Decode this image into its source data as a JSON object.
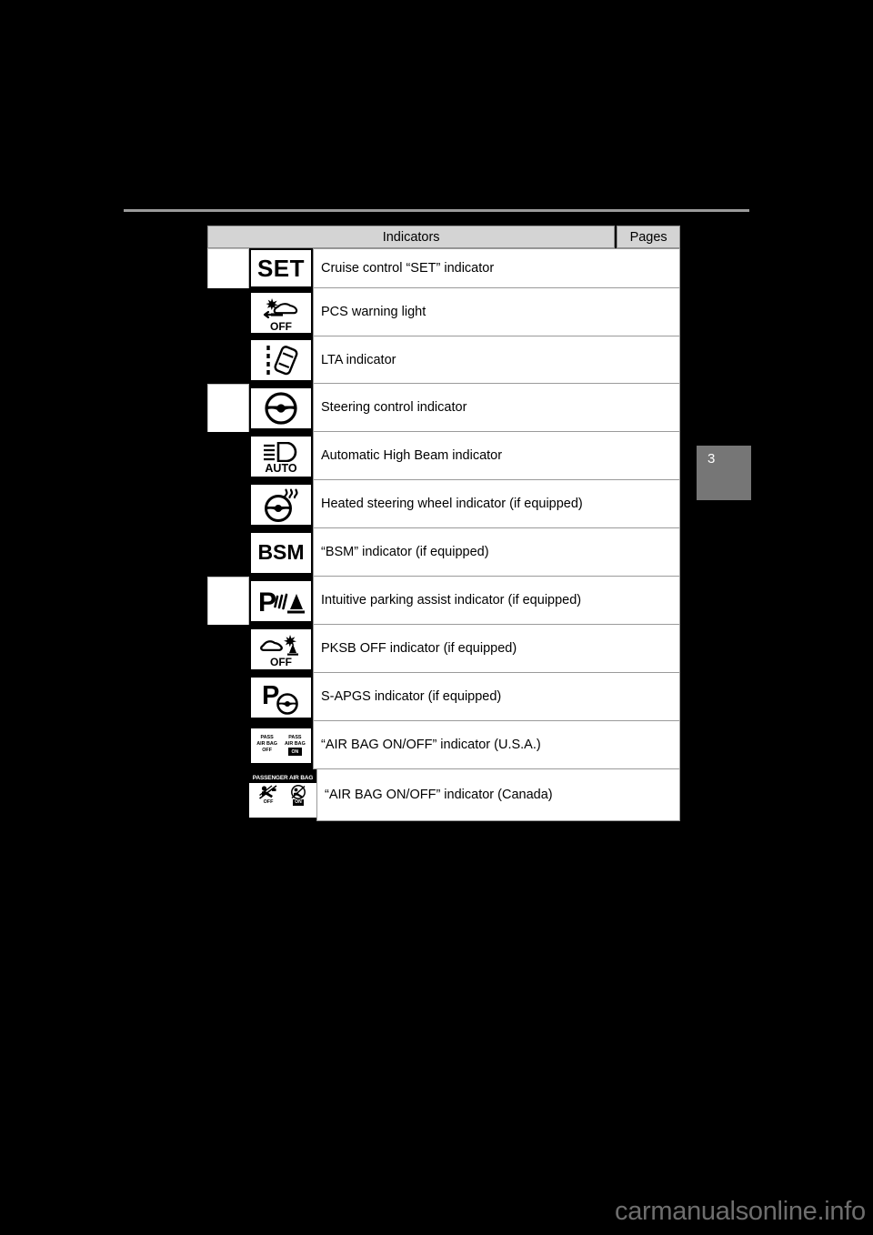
{
  "page": {
    "number": "3",
    "watermark": "carmanualsonline.info"
  },
  "table": {
    "headers": {
      "indicators": "Indicators",
      "pages": "Pages"
    },
    "rows": [
      {
        "icon": "cruise-control-set-icon",
        "icon_text": "SET",
        "description": "Cruise control “SET” indicator",
        "left_block": true,
        "page": ""
      },
      {
        "icon": "pcs-warning-off-icon",
        "icon_text": "OFF",
        "description": "PCS warning light",
        "left_block": false,
        "page": ""
      },
      {
        "icon": "lta-lane-tracing-icon",
        "icon_text": "",
        "description": "LTA indicator",
        "left_block": false,
        "page": ""
      },
      {
        "icon": "steering-wheel-icon",
        "icon_text": "",
        "description": "Steering control indicator",
        "left_block": true,
        "page": ""
      },
      {
        "icon": "automatic-high-beam-icon",
        "icon_text": "AUTO",
        "description": "Automatic High Beam indicator",
        "left_block": false,
        "page": ""
      },
      {
        "icon": "heated-steering-wheel-icon",
        "icon_text": "",
        "description": "Heated steering wheel indicator (if equipped)",
        "left_block": false,
        "page": ""
      },
      {
        "icon": "bsm-blind-spot-monitor-icon",
        "icon_text": "BSM",
        "description": "“BSM” indicator (if equipped)",
        "left_block": false,
        "page": ""
      },
      {
        "icon": "intuitive-parking-assist-icon",
        "icon_text": "P",
        "description": "Intuitive parking assist indicator (if equipped)",
        "left_block": true,
        "page": ""
      },
      {
        "icon": "pksb-off-icon",
        "icon_text": "OFF",
        "description": "PKSB OFF indicator (if equipped)",
        "left_block": false,
        "page": ""
      },
      {
        "icon": "s-apgs-icon",
        "icon_text": "P",
        "description": "S-APGS indicator (if equipped)",
        "left_block": false,
        "page": ""
      },
      {
        "icon": "air-bag-on-off-usa-icon",
        "icon_text": "PASS AIR BAG OFF / PASS AIR BAG ON",
        "description": "“AIR BAG ON/OFF” indicator (U.S.A.)",
        "left_block": false,
        "page": ""
      },
      {
        "icon": "air-bag-on-off-canada-icon",
        "icon_text": "PASSENGER AIR BAG",
        "description": "“AIR BAG ON/OFF” indicator (Canada)",
        "left_block": false,
        "page": ""
      }
    ],
    "airbag_usa": {
      "left_line1": "PASS",
      "left_line2": "AIR BAG",
      "left_line3": "OFF",
      "right_line1": "PASS",
      "right_line2": "AIR BAG",
      "right_badge": "ON"
    },
    "airbag_canada": {
      "title": "PASSENGER AIR BAG",
      "left_label": "OFF",
      "right_badge": "ON"
    }
  },
  "colors": {
    "background": "#000000",
    "header_fill": "#d4d4d4",
    "rule": "#9a9a9a",
    "page_tab": "#767676",
    "cell_border": "#9a9a9a",
    "watermark": "#6e6e6e"
  }
}
